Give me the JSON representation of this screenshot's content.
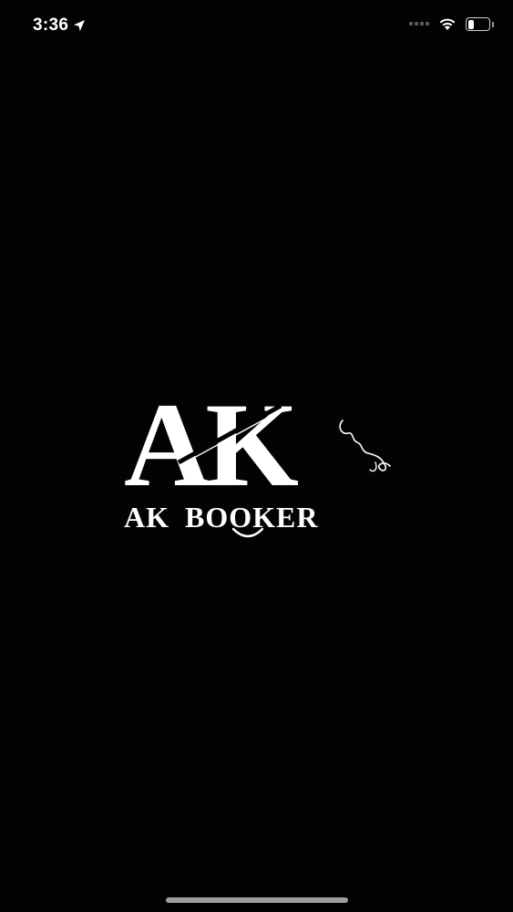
{
  "status_bar": {
    "time": "3:36",
    "location_icon": "location-arrow-icon",
    "signal_icon": "cellular-signal-icon",
    "wifi_icon": "wifi-icon",
    "battery_icon": "battery-icon",
    "battery_level": 0.25
  },
  "splash": {
    "monogram": "AK",
    "brand_name": "AK BOOKER",
    "background_color": "#030303",
    "logo_color": "#ffffff"
  }
}
